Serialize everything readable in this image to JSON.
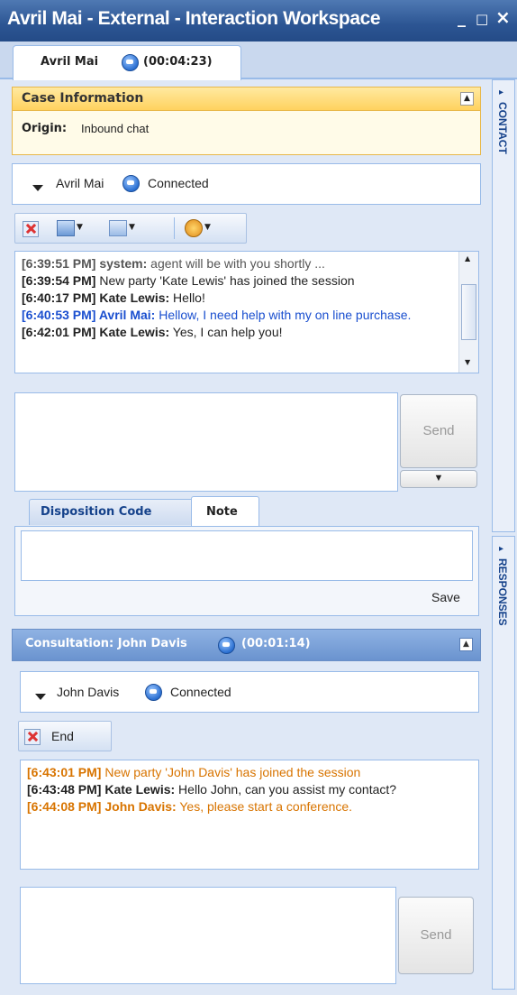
{
  "window": {
    "title": "Avril Mai - External - Interaction Workspace",
    "min": "_",
    "max": "□",
    "close": "×"
  },
  "interaction_tab": {
    "name": "Avril Mai",
    "timer": "(00:04:23)"
  },
  "case": {
    "header": "Case Information",
    "origin_label": "Origin:",
    "origin_value": "Inbound chat"
  },
  "party": {
    "name": "Avril Mai",
    "status": "Connected"
  },
  "chat": {
    "messages": [
      {
        "time": "[6:39:51 PM]",
        "sender": "system:",
        "text": "agent will be with you shortly ..."
      },
      {
        "time": "[6:39:54 PM]",
        "sender": "",
        "text": "New party 'Kate Lewis' has joined the session"
      },
      {
        "time": "[6:40:17 PM]",
        "sender": "Kate Lewis:",
        "text": "Hello!"
      },
      {
        "time": "[6:40:53 PM]",
        "sender": "Avril Mai:",
        "text": "Hellow, I need help with my on line purchase."
      },
      {
        "time": "[6:42:01 PM]",
        "sender": "Kate Lewis:",
        "text": "Yes, I can help you!"
      }
    ]
  },
  "send_label": "Send",
  "tabs": {
    "disposition": "Disposition Code",
    "note": "Note"
  },
  "note": {
    "save_label": "Save"
  },
  "sidebar": {
    "contact": "CONTACT",
    "responses": "RESPONSES"
  },
  "consultation": {
    "title": "Consultation: John Davis",
    "timer": "(00:01:14)",
    "party_name": "John Davis",
    "party_status": "Connected",
    "end_label": "End",
    "messages": [
      {
        "time": "[6:43:01 PM]",
        "sender": "",
        "text": "New party 'John Davis' has joined the session"
      },
      {
        "time": "[6:43:48 PM]",
        "sender": "Kate Lewis:",
        "text": "Hello John, can you assist my contact?"
      },
      {
        "time": "[6:44:08 PM]",
        "sender": "John Davis:",
        "text": "Yes, please start a conference."
      }
    ]
  },
  "colors": {
    "title_bar": "#2c5593",
    "case_header": "#ffd15c",
    "consult_header": "#6a93cf",
    "customer_text": "#1a4fcf",
    "consult_text": "#d87400"
  }
}
